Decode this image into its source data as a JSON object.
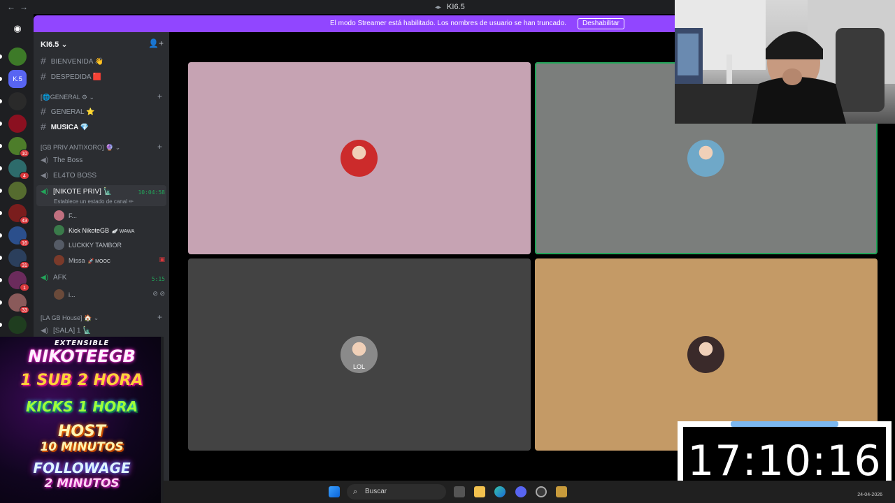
{
  "window": {
    "back_glyph": "←",
    "forward_glyph": "→",
    "title": "KI6.5",
    "title_icon": "voice-wave-icon"
  },
  "banner": {
    "message": "El modo Streamer está habilitado. Los nombres de usuario se han truncado.",
    "button": "Deshabilitar"
  },
  "rail": {
    "servers": [
      {
        "name": "discord-home",
        "color": "#1e1f22",
        "text": "",
        "badge": ""
      },
      {
        "name": "lucky",
        "color": "#3d7a28",
        "text": "",
        "badge": ""
      },
      {
        "name": "ki6-5",
        "color": "#5865f2",
        "text": "K.5",
        "badge": ""
      },
      {
        "name": "play",
        "color": "#2a2a2a",
        "text": "",
        "badge": ""
      },
      {
        "name": "tindervn",
        "color": "#8b1020",
        "text": "",
        "badge": ""
      },
      {
        "name": "green-server",
        "color": "#4d7d2a",
        "text": "",
        "badge": "10"
      },
      {
        "name": "skull-server",
        "color": "#2d6b6b",
        "text": "",
        "badge": "4"
      },
      {
        "name": "team-server",
        "color": "#556b2f",
        "text": "",
        "badge": ""
      },
      {
        "name": "red-server",
        "color": "#7a1d1d",
        "text": "",
        "badge": "43"
      },
      {
        "name": "blue-server",
        "color": "#2b4f8c",
        "text": "",
        "badge": "16"
      },
      {
        "name": "dark-server",
        "color": "#2b3f5c",
        "text": "",
        "badge": "31"
      },
      {
        "name": "pink-server",
        "color": "#6b2b5c",
        "text": "",
        "badge": "1"
      },
      {
        "name": "grey-server",
        "color": "#8a5a5a",
        "text": "",
        "badge": "33"
      },
      {
        "name": "alien-server",
        "color": "#1f3d1f",
        "text": "",
        "badge": ""
      }
    ]
  },
  "sidebar": {
    "guild_name": "KI6.5",
    "text_channels": [
      {
        "label": "BIENVENIDA 👋"
      },
      {
        "label": "DESPEDIDA 🟥"
      }
    ],
    "category_general": "[🌐GENERAL ⚙",
    "general_channels": [
      {
        "label": "GENERAL ⭐"
      },
      {
        "label": "MUSICA 💎"
      }
    ],
    "category_priv": "[GB PRIV ANTIXORO] 🔮",
    "voice_boss": "The Boss",
    "voice_el4to": "EL4TO BOSS",
    "voice_nikote": "[NIKOTE PRIV] 🗽",
    "voice_nikote_time": "10:04:58",
    "voice_nikote_status": "Establece un estado de canal ✏",
    "members": [
      {
        "name": "F...",
        "tag": "",
        "color": "#c0707f"
      },
      {
        "name": "Kick NikoteGB",
        "tag": "🪽 WAWA",
        "color": "#3a7a4a"
      },
      {
        "name": "LUCKKY TAMBOR",
        "tag": "",
        "color": "#555b66"
      },
      {
        "name": "Missa",
        "tag": "🚀 MOOC",
        "color": "#7a3a2a"
      }
    ],
    "voice_afk": "AFK",
    "voice_afk_time": "5:15",
    "afk_member": "i...",
    "category_house": "[LA GB House] 🏠",
    "voice_sala": "[SALA] 1 🗽"
  },
  "promo": {
    "line0": "EXTENSIBLE",
    "line1": "NIKOTEEGB",
    "line2": "1 SUB 2 HORA",
    "line3": "KICKS 1 HORA",
    "line4": "HOST",
    "line5": "10 MINUTOS",
    "line6": "FOLLOWAGE",
    "line7": "2 MINUTOS"
  },
  "tiles": [
    {
      "color": "#c6a3b3",
      "avatar_color": "#cc2b2b",
      "avatar_label": "",
      "speaking": false
    },
    {
      "color": "#7b7e7c",
      "avatar_color": "#6fa8c8",
      "avatar_label": "",
      "speaking": true
    },
    {
      "color": "#434343",
      "avatar_color": "#8a8a8a",
      "avatar_label": "LOL",
      "speaking": false
    },
    {
      "color": "#c49a66",
      "avatar_color": "#3a2a2a",
      "avatar_label": "",
      "speaking": false
    }
  ],
  "clock": {
    "time": "17:10:16"
  },
  "taskbar": {
    "search_placeholder": "Buscar",
    "date": "24-04-2026"
  },
  "colors": {
    "accent": "#9146ff",
    "online": "#23a55a",
    "badge": "#da373c"
  }
}
